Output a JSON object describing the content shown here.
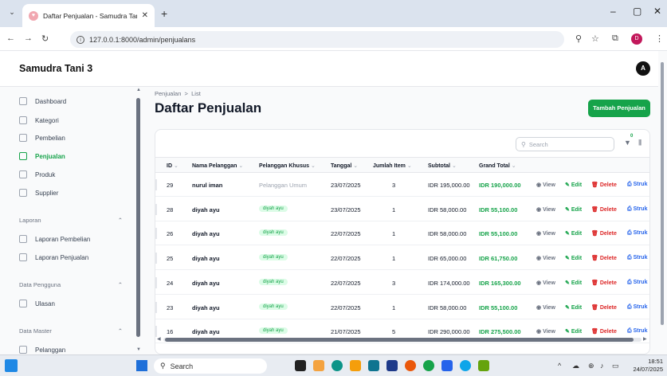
{
  "browser": {
    "tab_title": "Daftar Penjualan - Samudra Tan",
    "url": "127.0.0.1:8000/admin/penjualans",
    "profile_initial": "D"
  },
  "app": {
    "brand": "Samudra Tani 3",
    "avatar_initial": "A"
  },
  "sidebar": {
    "items": [
      {
        "label": "Dashboard",
        "icon": "home-icon"
      },
      {
        "label": "Kategori",
        "icon": "tag-icon"
      },
      {
        "label": "Pembelian",
        "icon": "cart-icon"
      },
      {
        "label": "Penjualan",
        "icon": "cash-icon",
        "active": true
      },
      {
        "label": "Produk",
        "icon": "box-icon"
      },
      {
        "label": "Supplier",
        "icon": "truck-icon"
      }
    ],
    "groups": {
      "laporan": "Laporan",
      "laporan_pembelian": "Laporan Pembelian",
      "laporan_penjualan": "Laporan Penjualan",
      "data_pengguna": "Data Pengguna",
      "ulasan": "Ulasan",
      "data_master": "Data Master",
      "pelanggan": "Pelanggan"
    }
  },
  "main": {
    "breadcrumb": {
      "parent": "Penjualan",
      "sep": ">",
      "current": "List"
    },
    "title": "Daftar Penjualan",
    "add_button": "Tambah Penjualan",
    "search_placeholder": "Search",
    "filter_count": "0"
  },
  "table": {
    "columns": [
      "ID",
      "Nama Pelanggan",
      "Pelanggan Khusus",
      "Tanggal",
      "Jumlah Item",
      "Subtotal",
      "Grand Total"
    ],
    "actions": {
      "view": "View",
      "edit": "Edit",
      "delete": "Delete",
      "struk": "Struk"
    },
    "rows": [
      {
        "id": "29",
        "nama": "nurul iman",
        "khusus": "Pelanggan Umum",
        "khusus_badge": false,
        "tanggal": "23/07/2025",
        "jumlah": "3",
        "subtotal": "IDR 195,000.00",
        "grand": "IDR 190,000.00"
      },
      {
        "id": "28",
        "nama": "diyah ayu",
        "khusus": "diyah ayu",
        "khusus_badge": true,
        "tanggal": "23/07/2025",
        "jumlah": "1",
        "subtotal": "IDR 58,000.00",
        "grand": "IDR 55,100.00"
      },
      {
        "id": "26",
        "nama": "diyah ayu",
        "khusus": "diyah ayu",
        "khusus_badge": true,
        "tanggal": "22/07/2025",
        "jumlah": "1",
        "subtotal": "IDR 58,000.00",
        "grand": "IDR 55,100.00"
      },
      {
        "id": "25",
        "nama": "diyah ayu",
        "khusus": "diyah ayu",
        "khusus_badge": true,
        "tanggal": "22/07/2025",
        "jumlah": "1",
        "subtotal": "IDR 65,000.00",
        "grand": "IDR 61,750.00"
      },
      {
        "id": "24",
        "nama": "diyah ayu",
        "khusus": "diyah ayu",
        "khusus_badge": true,
        "tanggal": "22/07/2025",
        "jumlah": "3",
        "subtotal": "IDR 174,000.00",
        "grand": "IDR 165,300.00"
      },
      {
        "id": "23",
        "nama": "diyah ayu",
        "khusus": "diyah ayu",
        "khusus_badge": true,
        "tanggal": "22/07/2025",
        "jumlah": "1",
        "subtotal": "IDR 58,000.00",
        "grand": "IDR 55,100.00"
      },
      {
        "id": "16",
        "nama": "diyah ayu",
        "khusus": "diyah ayu",
        "khusus_badge": true,
        "tanggal": "21/07/2025",
        "jumlah": "5",
        "subtotal": "IDR 290,000.00",
        "grand": "IDR 275,500.00"
      }
    ]
  },
  "taskbar": {
    "search": "Search",
    "time": "18:51",
    "date": "24/07/2025"
  },
  "colors": {
    "accent": "#16a34a",
    "danger": "#dc2626",
    "link": "#2563eb"
  }
}
